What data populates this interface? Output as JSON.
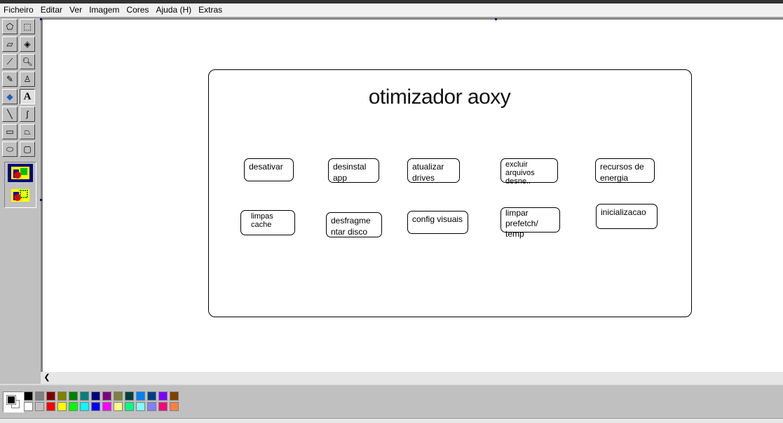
{
  "menu": [
    "Ficheiro",
    "Editar",
    "Ver",
    "Imagem",
    "Cores",
    "Ajuda (H)",
    "Extras"
  ],
  "tools": [
    {
      "name": "free-select-icon",
      "glyph": "⬠"
    },
    {
      "name": "rect-select-icon",
      "glyph": "⬚"
    },
    {
      "name": "eraser-icon",
      "glyph": "▱"
    },
    {
      "name": "fill-icon",
      "glyph": "◈"
    },
    {
      "name": "color-picker-icon",
      "glyph": "⟋"
    },
    {
      "name": "magnifier-icon",
      "glyph": "🔍︎"
    },
    {
      "name": "pencil-icon",
      "glyph": "✎"
    },
    {
      "name": "brush-icon",
      "glyph": "♙"
    },
    {
      "name": "airbrush-icon",
      "glyph": "◆"
    },
    {
      "name": "text-icon",
      "glyph": "A"
    },
    {
      "name": "line-icon",
      "glyph": "╲"
    },
    {
      "name": "curve-icon",
      "glyph": "∫"
    },
    {
      "name": "rectangle-icon",
      "glyph": "▭"
    },
    {
      "name": "polygon-icon",
      "glyph": "⏢"
    },
    {
      "name": "ellipse-icon",
      "glyph": "⬭"
    },
    {
      "name": "rounded-rect-icon",
      "glyph": "▢"
    }
  ],
  "palette": {
    "top": [
      "#000000",
      "#808080",
      "#800000",
      "#808000",
      "#008000",
      "#008080",
      "#000080",
      "#800080",
      "#808040",
      "#004040",
      "#0080ff",
      "#004080",
      "#8000ff",
      "#804000"
    ],
    "bottom": [
      "#ffffff",
      "#c0c0c0",
      "#ff0000",
      "#ffff00",
      "#00ff00",
      "#00ffff",
      "#0000ff",
      "#ff00ff",
      "#ffff80",
      "#00ff80",
      "#80ffff",
      "#8080ff",
      "#ff0080",
      "#ff8040"
    ]
  },
  "drawing": {
    "title": "otimizador aoxy",
    "buttons": [
      "desativar",
      "desinstal app",
      "atualizar drives",
      "excluir arquivos desne..",
      "recursos de energia",
      "limpas cache",
      "desfragme ntar disco",
      "config visuais",
      "limpar prefetch/ temp",
      "inicializacao"
    ]
  }
}
